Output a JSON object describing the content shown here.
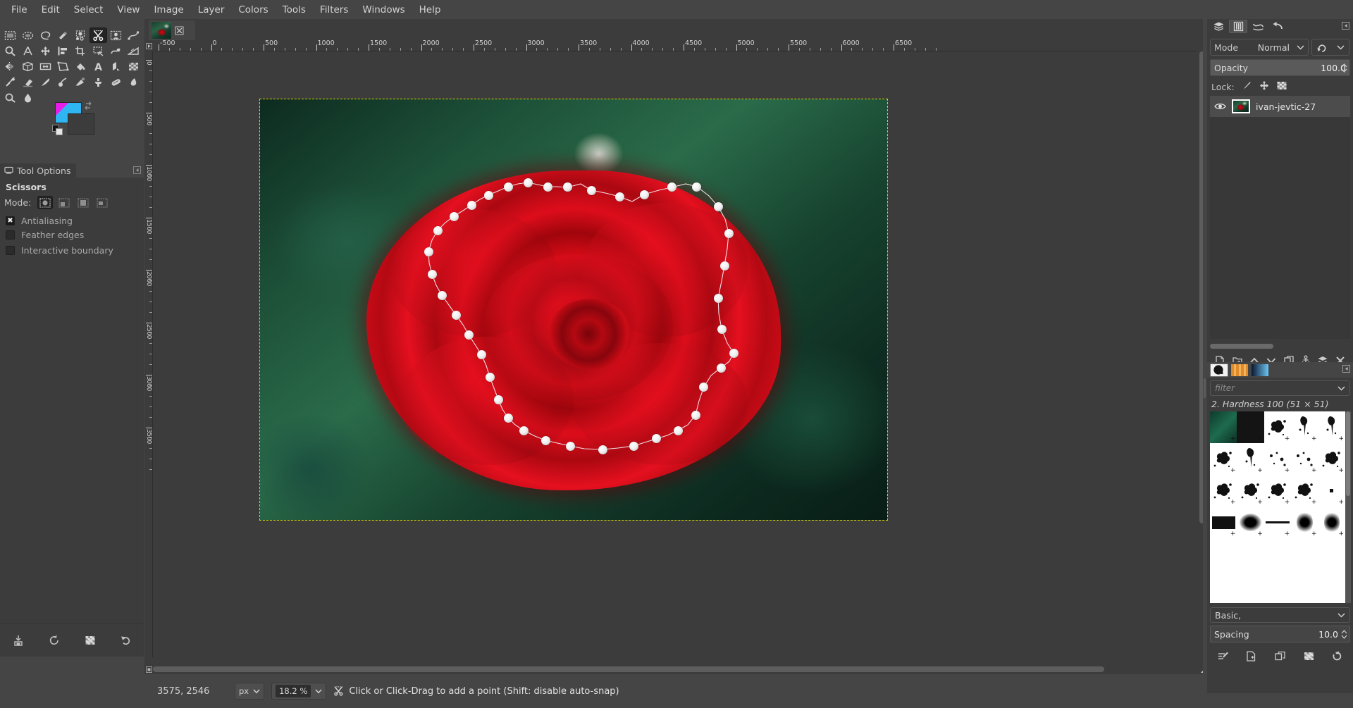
{
  "app": {
    "title": "GIMP"
  },
  "menubar": {
    "items": [
      {
        "label": "File"
      },
      {
        "label": "Edit"
      },
      {
        "label": "Select"
      },
      {
        "label": "View"
      },
      {
        "label": "Image"
      },
      {
        "label": "Layer"
      },
      {
        "label": "Colors"
      },
      {
        "label": "Tools"
      },
      {
        "label": "Filters"
      },
      {
        "label": "Windows"
      },
      {
        "label": "Help"
      }
    ]
  },
  "toolbox": {
    "tools": [
      {
        "name": "rectangle-select-icon"
      },
      {
        "name": "ellipse-select-icon"
      },
      {
        "name": "free-select-icon"
      },
      {
        "name": "fuzzy-select-icon"
      },
      {
        "name": "select-by-color-icon"
      },
      {
        "name": "scissors-select-icon",
        "active": true
      },
      {
        "name": "foreground-select-icon"
      },
      {
        "name": "paths-icon"
      },
      {
        "name": "zoom-icon"
      },
      {
        "name": "measure-icon"
      },
      {
        "name": "move-icon"
      },
      {
        "name": "align-icon"
      },
      {
        "name": "crop-icon"
      },
      {
        "name": "transform-icon"
      },
      {
        "name": "warp-transform-icon"
      },
      {
        "name": "perspective-clone-icon"
      },
      {
        "name": "flip-icon"
      },
      {
        "name": "cage-transform-icon"
      },
      {
        "name": "handle-transform-icon"
      },
      {
        "name": "unified-transform-icon"
      },
      {
        "name": "bucket-fill-icon"
      },
      {
        "name": "text-icon"
      },
      {
        "name": "gradient-icon"
      },
      {
        "name": "pattern-fill-icon"
      },
      {
        "name": "paintbrush-icon"
      },
      {
        "name": "eraser-icon"
      },
      {
        "name": "ink-icon"
      },
      {
        "name": "mypaint-brush-icon"
      },
      {
        "name": "airbrush-icon"
      },
      {
        "name": "clone-icon"
      },
      {
        "name": "heal-icon"
      },
      {
        "name": "smudge-icon"
      },
      {
        "name": "dodge-burn-icon"
      },
      {
        "name": "blur-sharpen-icon"
      }
    ],
    "colors": {
      "foreground_hex": "#2fb6f2",
      "foreground_accent_hex": "#e81ee8",
      "background_hex": "#3c3c3c",
      "swap_icon": "swap-colors-icon",
      "reset_icon": "reset-colors-icon"
    }
  },
  "tool_options": {
    "tab_label": "Tool Options",
    "tab_icon": "tool-options-icon",
    "menu_icon": "panel-menu-icon",
    "title": "Scissors",
    "mode_label": "Mode:",
    "modes": [
      {
        "name": "replace-selection-mode",
        "active": true
      },
      {
        "name": "add-to-selection-mode",
        "active": false
      },
      {
        "name": "subtract-from-selection-mode",
        "active": false
      },
      {
        "name": "intersect-with-selection-mode",
        "active": false
      }
    ],
    "checkboxes": [
      {
        "label": "Antialiasing",
        "checked": true
      },
      {
        "label": "Feather edges",
        "checked": false
      },
      {
        "label": "Interactive boundary",
        "checked": false
      }
    ],
    "bottom_buttons": [
      {
        "name": "save-tool-preset-button"
      },
      {
        "name": "restore-tool-preset-button"
      },
      {
        "name": "delete-tool-preset-button"
      },
      {
        "name": "reset-tool-options-button"
      }
    ]
  },
  "image_tab": {
    "thumbnail_name": "image-thumbnail-rose",
    "close_icon": "close-icon"
  },
  "canvas": {
    "ruler_unit": "px",
    "h_ruler_labels": [
      "-500",
      "0",
      "500",
      "1000",
      "1500",
      "2000",
      "2500",
      "3000",
      "3500",
      "4000",
      "4500",
      "5000",
      "5500",
      "6000",
      "6500"
    ],
    "v_ruler_labels": [
      "0",
      "500",
      "1000",
      "1500",
      "2000",
      "2500",
      "3000",
      "3500"
    ],
    "quickmask_icon": "quick-mask-toggle-icon",
    "navigate_icon": "navigate-canvas-icon",
    "ruler_origin_icon": "ruler-origin-icon",
    "selection_tool": "scissors-path",
    "selection_border_color": "#cfd400"
  },
  "statusbar": {
    "position": "3575, 2546",
    "unit": "px",
    "zoom": "18.2 %",
    "hint_icon": "scissors-select-icon",
    "hint": "Click or Click-Drag to add a point (Shift: disable auto-snap)"
  },
  "right_dock": {
    "tabs": [
      {
        "name": "tab-layers",
        "active": false
      },
      {
        "name": "tab-channels",
        "active": true
      },
      {
        "name": "tab-paths",
        "active": false
      },
      {
        "name": "tab-undo-history",
        "active": false
      }
    ],
    "menu_icon": "panel-menu-icon",
    "layers": {
      "mode_label": "Mode",
      "mode_value": "Normal",
      "mode_dropdown_icon": "chevron-down-icon",
      "switch_icon": "composite-mode-icon",
      "opacity_label": "Opacity",
      "opacity_value": "100.0",
      "lock_label": "Lock:",
      "lock_icons": [
        {
          "name": "lock-pixels-icon"
        },
        {
          "name": "lock-position-icon"
        },
        {
          "name": "lock-alpha-icon"
        }
      ],
      "items": [
        {
          "name": "ivan-jevtic-27",
          "visible": true,
          "thumbnail_name": "layer-thumbnail-rose"
        }
      ],
      "buttons": [
        {
          "name": "new-layer-button"
        },
        {
          "name": "new-layer-group-button"
        },
        {
          "name": "raise-layer-button"
        },
        {
          "name": "lower-layer-button"
        },
        {
          "name": "duplicate-layer-button"
        },
        {
          "name": "anchor-layer-button"
        },
        {
          "name": "merge-down-button"
        },
        {
          "name": "delete-layer-button"
        }
      ]
    },
    "brushes": {
      "tabs": [
        {
          "name": "tab-brushes",
          "active": true
        },
        {
          "name": "tab-patterns",
          "active": false
        },
        {
          "name": "tab-gradients",
          "active": false
        }
      ],
      "menu_icon": "panel-menu-icon",
      "filter_placeholder": "filter",
      "filter_value": "",
      "filter_dropdown_icon": "chevron-down-icon",
      "selected_brush": "2. Hardness 100 (51 × 51)",
      "tag_value": "Basic,",
      "tag_dropdown_icon": "chevron-down-icon",
      "spacing_label": "Spacing",
      "spacing_value": "10.0",
      "buttons": [
        {
          "name": "edit-brush-button"
        },
        {
          "name": "new-brush-button"
        },
        {
          "name": "duplicate-brush-button"
        },
        {
          "name": "delete-brush-button"
        },
        {
          "name": "refresh-brushes-button"
        }
      ]
    }
  }
}
